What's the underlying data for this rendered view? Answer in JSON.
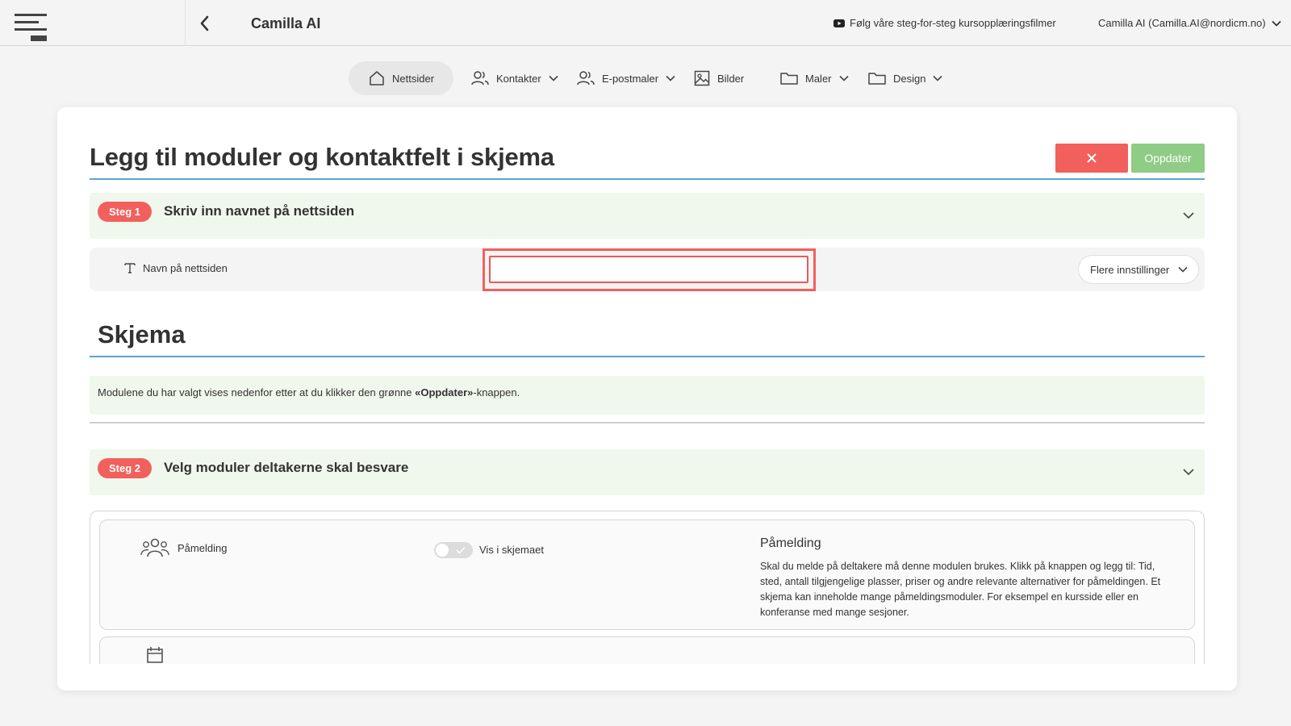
{
  "header": {
    "app_title": "Camilla AI",
    "tutorial_text": "Følg våre steg-for-steg kursopplæringsfilmer",
    "user_text": "Camilla AI (Camilla.AI@nordicm.no)"
  },
  "nav": {
    "items": [
      {
        "label": "Nettsider",
        "icon": "home-icon"
      },
      {
        "label": "Kontakter",
        "icon": "users-icon"
      },
      {
        "label": "E-postmaler",
        "icon": "users-icon"
      },
      {
        "label": "Bilder",
        "icon": "image-icon"
      },
      {
        "label": "Maler",
        "icon": "folder-icon"
      },
      {
        "label": "Design",
        "icon": "folder-icon"
      }
    ]
  },
  "page": {
    "title": "Legg til moduler og kontaktfelt i skjema",
    "update_label": "Oppdater"
  },
  "step1": {
    "badge": "Steg 1",
    "title": "Skriv inn navnet på nettsiden",
    "field_label": "Navn på nettsiden",
    "field_value": "",
    "more_settings": "Flere innstillinger"
  },
  "schema": {
    "title": "Skjema",
    "info_prefix": "Modulene du har valgt vises nedenfor etter at du klikker den grønne ",
    "info_bold": "«Oppdater»",
    "info_suffix": "-knappen."
  },
  "step2": {
    "badge": "Steg 2",
    "title": "Velg moduler deltakerne skal besvare"
  },
  "modules": [
    {
      "label": "Påmelding",
      "toggle_label": "Vis i skjemaet",
      "toggle_on": false,
      "heading": "Påmelding",
      "description": "Skal du melde på deltakere må denne modulen brukes. Klikk på knappen og legg til: Tid, sted, antall tilgjengelige plasser, priser og andre relevante alternativer for påmeldingen. Et skjema kan inneholde mange påmeldingsmoduler. For eksempel en kursside eller en konferanse med mange sesjoner."
    }
  ],
  "colors": {
    "accent_red": "#f1605c",
    "accent_green": "#8fcc85",
    "step_bg": "#f0f7ec",
    "rule_blue": "#5aa6d3"
  }
}
